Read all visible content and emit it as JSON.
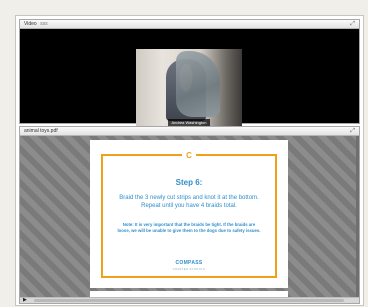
{
  "video_pod": {
    "title": "Video",
    "title_extra": "sss",
    "maximize_glyph": "⤢",
    "speaker_name": "Andrea Washington",
    "icons": {
      "maximize": "maximize-icon"
    }
  },
  "pdf_pod": {
    "title": "animal toys.pdf",
    "maximize_glyph": "⤢",
    "play_glyph": "▶",
    "slide": {
      "logo_glyph": "C",
      "title": "Step 6:",
      "body": "Braid the 3 newly cut strips and knot it at the bottom. Repeat until you have 4 braids total.",
      "note": "Note: It is very important that the braids be tight. If the braids are loose, we will be unable to give them to the dogs due to safety issues.",
      "brand": "COMPASS",
      "brand_sub": "CHARTER SCHOOLS"
    },
    "icons": {
      "maximize": "maximize-icon",
      "play": "play-icon"
    }
  },
  "colors": {
    "accent_orange": "#f0a11a",
    "text_blue": "#2f8ec9"
  }
}
